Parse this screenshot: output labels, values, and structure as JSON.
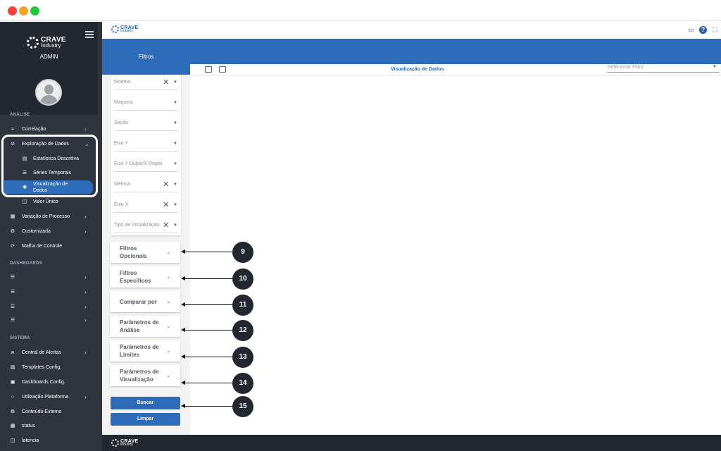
{
  "window": {
    "controls": [
      "close",
      "minimize",
      "maximize"
    ]
  },
  "sidebar": {
    "brand_line1": "CRAVE",
    "brand_line2": "Industry",
    "user_role": "ADMIN",
    "section_analise": "ANÁLISE",
    "section_dashboards": "DASHBOARDS",
    "section_sistema": "SISTEMA",
    "items": {
      "correlacao": "Correlação",
      "exploracao": "Exploração de Dados",
      "estatistica": "Estatística Descritiva",
      "series": "Séries Temporais",
      "visualizacao": "Visualização de Dados",
      "valor_unico": "Valor Único",
      "variacao": "Variação de Processo",
      "customizada": "Customizada",
      "malha": "Malha de Controle",
      "alertas": "Central de Alertas",
      "templates": "Templates Config.",
      "dashboards_config": "Dashboards Config.",
      "utilizacao": "Utilização Plataforma",
      "conteudo": "Conteúdo Externo",
      "status": "status",
      "latencia": "latencia"
    }
  },
  "topbar": {
    "brand_line1": "CRAVE",
    "brand_line2": "Industry"
  },
  "filters": {
    "header": "Filtros",
    "fields": [
      "Modelo",
      "Máquina",
      "Seção",
      "Eixo Y",
      "Eixo Y-Duplo/X-Dispersão",
      "Métrica",
      "Eixo X",
      "Tipo de Visualização"
    ],
    "accordions": {
      "opcionais": "Filtros Opcionais",
      "especificos": "Filtros Especificos",
      "comparar": "Comparar por",
      "analise": "Parâmetros de Análise",
      "limites": "Parâmetros de Limites",
      "visualizacao": "Parâmetros de Visualização"
    },
    "buscar": "Buscar",
    "limpar": "Limpar"
  },
  "content": {
    "title": "Visualização de Dados",
    "select_placeholder": "Selecionar Filtro"
  },
  "callouts": [
    "9",
    "10",
    "11",
    "12",
    "13",
    "14",
    "15"
  ],
  "colors": {
    "primary": "#2c6cb8",
    "sidebar": "#2f343f",
    "callout": "#232830"
  }
}
